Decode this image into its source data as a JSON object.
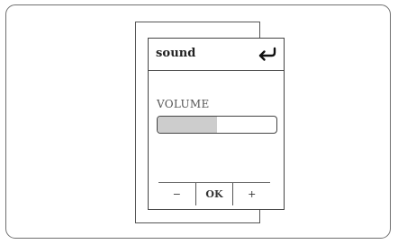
{
  "screen": {
    "title": "sound",
    "back_icon": "return-arrow-icon"
  },
  "volume": {
    "label": "VOLUME",
    "level": 0.5
  },
  "buttons": {
    "minus": "−",
    "ok": "OK",
    "plus": "+"
  },
  "colors": {
    "fill": "#cdcdcd",
    "border": "#444444"
  }
}
